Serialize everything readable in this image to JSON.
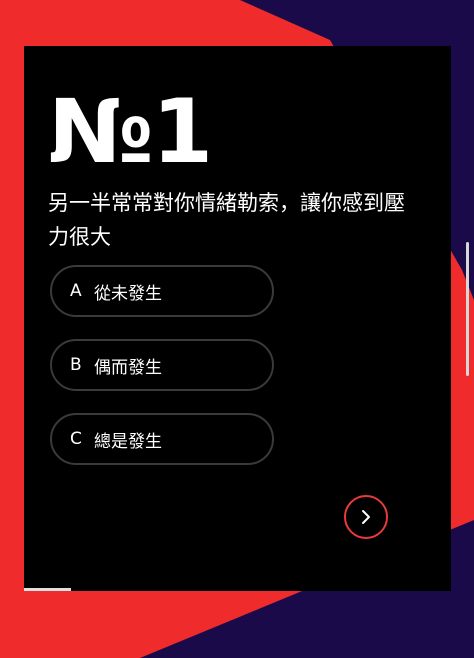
{
  "quiz": {
    "number": "№1",
    "question": "另一半常常對你情緒勒索，讓你感到壓力很大",
    "options": [
      {
        "letter": "A",
        "text": "從未發生"
      },
      {
        "letter": "B",
        "text": "偶而發生"
      },
      {
        "letter": "C",
        "text": "總是發生"
      }
    ],
    "next_icon": "chevron-right-icon",
    "progress": 0.11
  },
  "colors": {
    "background_red": "#ef2b2b",
    "background_navy": "#1a0a4a",
    "card": "#000000",
    "accent": "#e83a3a"
  }
}
